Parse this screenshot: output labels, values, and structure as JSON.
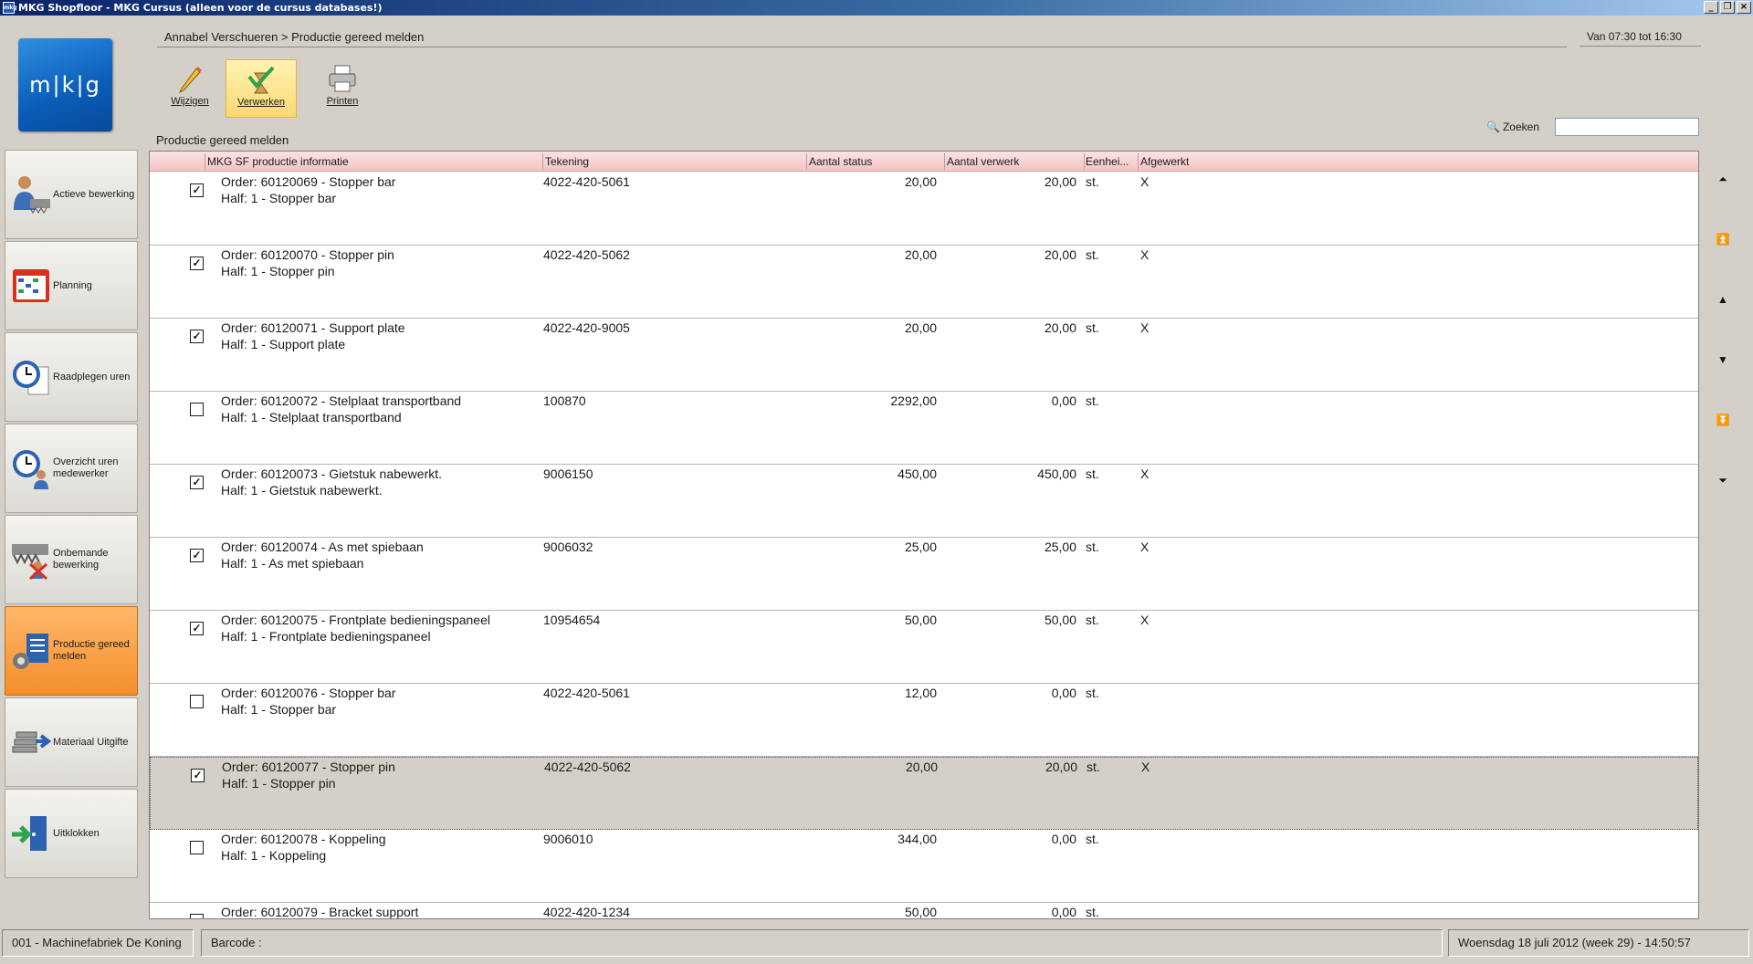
{
  "window": {
    "title": "MKG Shopfloor - MKG Cursus (alleen voor de cursus databases!)",
    "icon_text": "mkg"
  },
  "logo": {
    "text": "m|k|g",
    "color": "#1467c4"
  },
  "sidebar": {
    "items": [
      {
        "label": "Actieve bewerking",
        "icon": "worker-icon"
      },
      {
        "label": "Planning",
        "icon": "planning-icon"
      },
      {
        "label": "Raadplegen uren",
        "icon": "clock-document-icon"
      },
      {
        "label": "Overzicht uren medewerker",
        "icon": "clock-person-icon"
      },
      {
        "label": "Onbemande bewerking",
        "icon": "unmanned-icon"
      },
      {
        "label": "Productie gereed melden",
        "icon": "production-ready-icon",
        "active": true
      },
      {
        "label": "Materiaal Uitgifte",
        "icon": "material-icon"
      },
      {
        "label": "Uitklokken",
        "icon": "exit-door-icon"
      }
    ]
  },
  "header": {
    "breadcrumb": "Annabel Verschueren > Productie gereed melden",
    "time_range": "Van 07:30 tot 16:30"
  },
  "toolbar": {
    "edit_label": "Wijzigen",
    "process_label": "Verwerken",
    "print_label": "Printen"
  },
  "list": {
    "title": "Productie gereed melden",
    "search_label": "Zoeken",
    "search_value": "",
    "columns": [
      "MKG SF productie informatie",
      "Tekening",
      "Aantal status",
      "Aantal verwerk",
      "Eenhei...",
      "Afgewerkt"
    ],
    "rows": [
      {
        "checked": true,
        "order": "Order: 60120069 - Stopper bar",
        "half": "Half: 1 - Stopper bar",
        "drawing": "4022-420-5061",
        "qty_status": "20,00",
        "qty_processed": "20,00",
        "unit": "st.",
        "done": "X"
      },
      {
        "checked": true,
        "order": "Order: 60120070 - Stopper pin",
        "half": "Half: 1 - Stopper pin",
        "drawing": "4022-420-5062",
        "qty_status": "20,00",
        "qty_processed": "20,00",
        "unit": "st.",
        "done": "X"
      },
      {
        "checked": true,
        "order": "Order: 60120071 - Support plate",
        "half": "Half: 1 - Support plate",
        "drawing": "4022-420-9005",
        "qty_status": "20,00",
        "qty_processed": "20,00",
        "unit": "st.",
        "done": "X"
      },
      {
        "checked": false,
        "order": "Order: 60120072 - Stelplaat transportband",
        "half": "Half: 1 - Stelplaat transportband",
        "drawing": "100870",
        "qty_status": "2292,00",
        "qty_processed": "0,00",
        "unit": "st.",
        "done": ""
      },
      {
        "checked": true,
        "order": "Order: 60120073 - Gietstuk nabewerkt.",
        "half": "Half: 1 - Gietstuk nabewerkt.",
        "drawing": "9006150",
        "qty_status": "450,00",
        "qty_processed": "450,00",
        "unit": "st.",
        "done": "X"
      },
      {
        "checked": true,
        "order": "Order: 60120074 - As met spiebaan",
        "half": "Half: 1 - As met spiebaan",
        "drawing": "9006032",
        "qty_status": "25,00",
        "qty_processed": "25,00",
        "unit": "st.",
        "done": "X"
      },
      {
        "checked": true,
        "order": "Order: 60120075 - Frontplate bedieningspaneel",
        "half": "Half: 1 - Frontplate bedieningspaneel",
        "drawing": "10954654",
        "qty_status": "50,00",
        "qty_processed": "50,00",
        "unit": "st.",
        "done": "X"
      },
      {
        "checked": false,
        "order": "Order: 60120076 - Stopper bar",
        "half": "Half: 1 - Stopper bar",
        "drawing": "4022-420-5061",
        "qty_status": "12,00",
        "qty_processed": "0,00",
        "unit": "st.",
        "done": ""
      },
      {
        "checked": true,
        "order": "Order: 60120077 - Stopper pin",
        "half": "Half: 1 - Stopper pin",
        "drawing": "4022-420-5062",
        "qty_status": "20,00",
        "qty_processed": "20,00",
        "unit": "st.",
        "done": "X",
        "selected": true
      },
      {
        "checked": false,
        "order": "Order: 60120078 - Koppeling",
        "half": "Half: 1 - Koppeling",
        "drawing": "9006010",
        "qty_status": "344,00",
        "qty_processed": "0,00",
        "unit": "st.",
        "done": ""
      },
      {
        "checked": false,
        "order": "Order: 60120079 - Bracket support",
        "half": "",
        "drawing": "4022-420-1234",
        "qty_status": "50,00",
        "qty_processed": "0,00",
        "unit": "st.",
        "done": ""
      }
    ]
  },
  "scroll_nav": [
    "first-icon",
    "page-up-icon",
    "up-icon",
    "down-icon",
    "page-down-icon",
    "last-icon"
  ],
  "statusbar": {
    "company": "001 - Machinefabriek De Koning",
    "barcode_label": "Barcode :",
    "datetime": "Woensdag 18 juli 2012 (week 29) - 14:50:57"
  },
  "colors": {
    "accent": "#f38e2a",
    "header_row": "#f4c4c4",
    "selected_row": "#d4d0c8"
  }
}
